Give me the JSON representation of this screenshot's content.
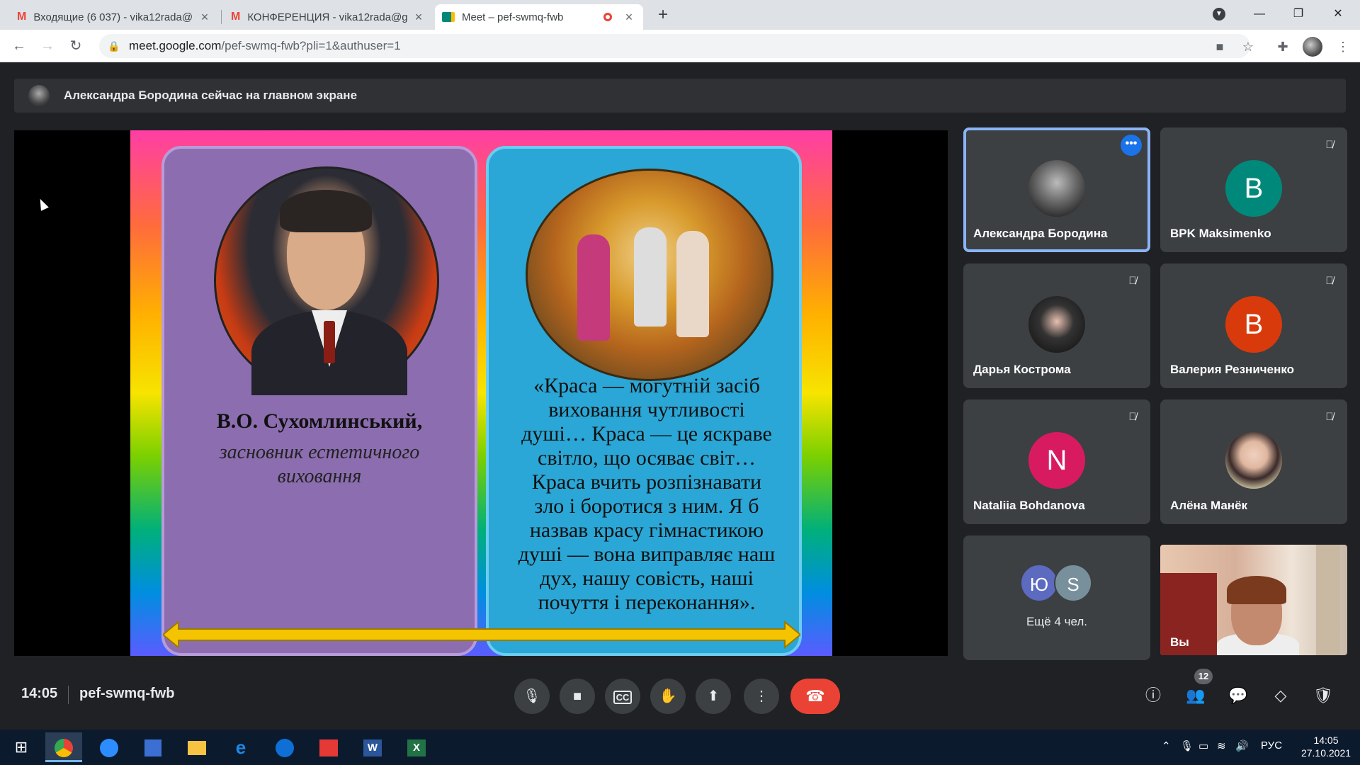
{
  "browser": {
    "tabs": [
      {
        "icon": "gmail-icon",
        "title": "Входящие (6 037) - vika12rada@",
        "active": false
      },
      {
        "icon": "gmail-icon",
        "title": "КОНФЕРЕНЦИЯ - vika12rada@g",
        "active": false
      },
      {
        "icon": "meet-icon",
        "title": "Meet – pef-swmq-fwb",
        "active": true
      }
    ],
    "url_host": "meet.google.com",
    "url_path": "/pef-swmq-fwb?pli=1&authuser=1"
  },
  "banner": {
    "text": "Александра Бородина сейчас на главном экране"
  },
  "slide": {
    "name": "В.О. Сухомлинський,",
    "role_line1": "засновник естетичного",
    "role_line2": "виховання",
    "quote_lines": [
      "«Краса — могутній засіб",
      "виховання чутливості",
      "душі… Краса — це яскраве",
      "світло, що осяває світ…",
      "Краса вчить розпізнавати",
      "зло і боротися з ним. Я б",
      "назвав красу гімнастикою",
      "душі — вона виправляє наш",
      "дух, нашу совість, наші",
      "почуття і переконання»."
    ]
  },
  "participants": [
    {
      "name": "Александра Бородина",
      "avatar": "photo",
      "muted": false,
      "active": true
    },
    {
      "name": "BPK Maksimenko",
      "avatar_letter": "B",
      "avatar_color": "#00897b",
      "muted": true
    },
    {
      "name": "Дарья Кострома",
      "avatar": "photo",
      "muted": true
    },
    {
      "name": "Валерия Резниченко",
      "avatar_letter": "B",
      "avatar_color": "#d93a0b",
      "muted": true
    },
    {
      "name": "Nataliia Bohdanova",
      "avatar_letter": "N",
      "avatar_color": "#d81b60",
      "muted": true
    },
    {
      "name": "Алёна Манёк",
      "avatar": "photo",
      "muted": true
    }
  ],
  "more": {
    "label": "Ещё 4 чел.",
    "avatars": [
      {
        "letter": "Ю",
        "color": "#5c6bc0"
      },
      {
        "letter": "S",
        "color": "#78909c"
      }
    ]
  },
  "self_view": {
    "label": "Вы"
  },
  "bottom": {
    "time": "14:05",
    "meeting_code": "pef-swmq-fwb",
    "participant_count": "12"
  },
  "taskbar": {
    "tray_lang": "РУС",
    "tray_time": "14:05",
    "tray_date": "27.10.2021"
  }
}
